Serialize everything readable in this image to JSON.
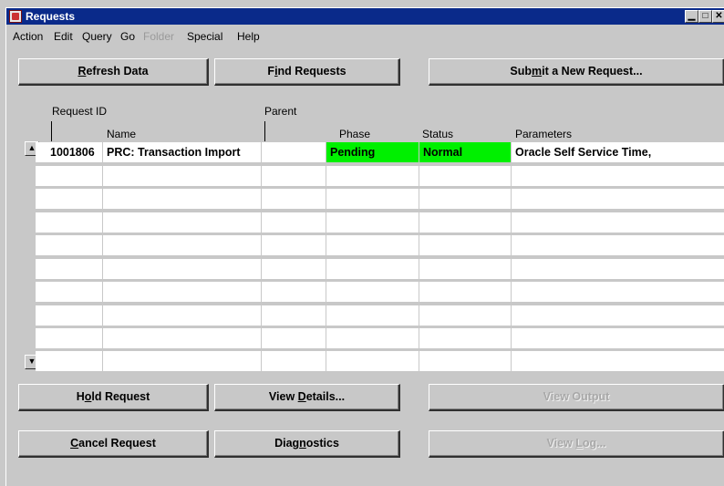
{
  "window": {
    "title": "Requests",
    "controls": {
      "minimize": "▁",
      "maximize": "□",
      "close": "✕"
    }
  },
  "menu": {
    "items": [
      {
        "label": "Action",
        "enabled": true
      },
      {
        "label": "Edit",
        "enabled": true
      },
      {
        "label": "Query",
        "enabled": true
      },
      {
        "label": "Go",
        "enabled": true
      },
      {
        "label": "Folder",
        "enabled": false
      },
      {
        "label": "Special",
        "enabled": true
      },
      {
        "label": "Help",
        "enabled": true
      }
    ]
  },
  "top_buttons": {
    "refresh_pre": "",
    "refresh_key": "R",
    "refresh_post": "efresh Data",
    "find_pre": "F",
    "find_key": "i",
    "find_post": "nd Requests",
    "submit_pre": "Submit a New Request...",
    "submit_a": "Sub",
    "submit_key": "m",
    "submit_b": "it a New Request..."
  },
  "columns": {
    "request_id": "Request ID",
    "name": "Name",
    "parent": "Parent",
    "phase": "Phase",
    "status": "Status",
    "parameters": "Parameters"
  },
  "rows": [
    {
      "request_id": "1001806",
      "name": "PRC: Transaction Import",
      "parent": "",
      "phase": "Pending",
      "status": "Normal",
      "parameters": "Oracle Self Service Time,"
    }
  ],
  "colors": {
    "title_bar": "#0a2a8a",
    "phase_pending": "#00f000",
    "status_normal": "#00f000",
    "current_record": "#6f8fd0"
  },
  "bottom_buttons": {
    "hold_a": "H",
    "hold_key": "o",
    "hold_b": "ld Request",
    "details_a": "View ",
    "details_key": "D",
    "details_b": "etails...",
    "output": "View Output",
    "cancel_key": "C",
    "cancel_b": "ancel Request",
    "diag_a": "Diag",
    "diag_key": "n",
    "diag_b": "ostics",
    "log_a": "View ",
    "log_key": "L",
    "log_b": "og..."
  },
  "scroll": {
    "up_icon": "▲",
    "down_icon": "▼"
  }
}
